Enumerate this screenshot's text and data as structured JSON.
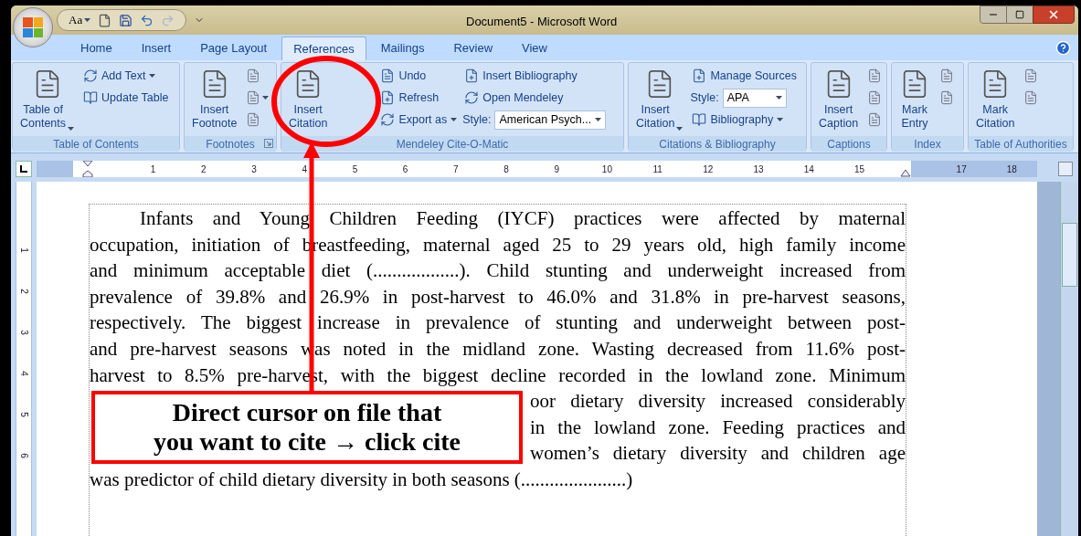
{
  "title_bar": {
    "quick_access_font": "Aa",
    "title": "Document5 - Microsoft Word"
  },
  "tabs": [
    {
      "label": "Home",
      "selected": false
    },
    {
      "label": "Insert",
      "selected": false
    },
    {
      "label": "Page Layout",
      "selected": false
    },
    {
      "label": "References",
      "selected": true
    },
    {
      "label": "Mailings",
      "selected": false
    },
    {
      "label": "Review",
      "selected": false
    },
    {
      "label": "View",
      "selected": false
    }
  ],
  "ribbon_groups": [
    {
      "name": "Table of Contents",
      "launcher": false,
      "columns": [
        [
          {
            "kind": "large",
            "label": "Table of\nContents",
            "dropdown": true
          }
        ],
        [
          {
            "kind": "small",
            "label": "Add Text",
            "dropdown": true
          },
          {
            "kind": "small",
            "label": "Update Table",
            "dropdown": false
          }
        ]
      ]
    },
    {
      "name": "Footnotes",
      "launcher": true,
      "columns": [
        [
          {
            "kind": "large",
            "label": "Insert\nFootnote",
            "dropdown": false
          }
        ],
        [
          {
            "kind": "icon",
            "dropdown": false
          },
          {
            "kind": "icon",
            "dropdown": true
          },
          {
            "kind": "icon",
            "dropdown": false
          }
        ]
      ]
    },
    {
      "name": "Mendeley Cite-O-Matic",
      "launcher": false,
      "columns": [
        [
          {
            "kind": "large",
            "label": "Insert\nCitation",
            "dropdown": false
          }
        ],
        [
          {
            "kind": "small",
            "label": "Undo",
            "dropdown": false
          },
          {
            "kind": "small",
            "label": "Refresh",
            "dropdown": false
          },
          {
            "kind": "small",
            "label": "Export as",
            "dropdown": true
          }
        ],
        [
          {
            "kind": "small",
            "label": "Insert Bibliography",
            "dropdown": false
          },
          {
            "kind": "small",
            "label": "Open Mendeley",
            "dropdown": false
          },
          {
            "kind": "combo",
            "label": "Style:",
            "value": "American Psych...",
            "dropdown": true
          }
        ]
      ]
    },
    {
      "name": "Citations & Bibliography",
      "launcher": false,
      "columns": [
        [
          {
            "kind": "large",
            "label": "Insert\nCitation",
            "dropdown": true
          }
        ],
        [
          {
            "kind": "small",
            "label": "Manage Sources",
            "dropdown": false
          },
          {
            "kind": "combo",
            "label": "Style:",
            "value": "APA",
            "dropdown": true
          },
          {
            "kind": "small",
            "label": "Bibliography",
            "dropdown": true
          }
        ]
      ]
    },
    {
      "name": "Captions",
      "launcher": false,
      "columns": [
        [
          {
            "kind": "large",
            "label": "Insert\nCaption",
            "dropdown": false
          }
        ],
        [
          {
            "kind": "icon",
            "dropdown": false
          },
          {
            "kind": "icon",
            "dropdown": false
          },
          {
            "kind": "icon",
            "dropdown": false
          }
        ]
      ]
    },
    {
      "name": "Index",
      "launcher": false,
      "columns": [
        [
          {
            "kind": "large",
            "label": "Mark\nEntry",
            "dropdown": false
          }
        ],
        [
          {
            "kind": "icon",
            "dropdown": false
          },
          {
            "kind": "icon",
            "dropdown": false
          }
        ]
      ]
    },
    {
      "name": "Table of Authorities",
      "launcher": false,
      "columns": [
        [
          {
            "kind": "large",
            "label": "Mark\nCitation",
            "dropdown": false
          }
        ],
        [
          {
            "kind": "icon",
            "dropdown": false
          },
          {
            "kind": "icon",
            "dropdown": false
          }
        ]
      ]
    }
  ],
  "ruler": [
    "1",
    "2",
    "3",
    "4",
    "5",
    "6",
    "7",
    "8",
    "9",
    "10",
    "11",
    "12",
    "13",
    "14",
    "15",
    "17",
    "18"
  ],
  "vertical_ruler": [
    "1",
    "2",
    "3",
    "4",
    "5",
    "6"
  ],
  "document_lines": [
    {
      "kind": "first",
      "text": "Infants and Young Children Feeding (IYCF) practices were affected by maternal"
    },
    {
      "kind": "full",
      "text": "occupation, initiation of breastfeeding, maternal aged 25 to 29 years old, high family income"
    },
    {
      "kind": "full",
      "text": "and minimum acceptable diet (..................). Child stunting and underweight increased from"
    },
    {
      "kind": "full",
      "text": "prevalence of 39.8% and 26.9% in post-harvest to 46.0% and 31.8% in pre-harvest seasons,"
    },
    {
      "kind": "full",
      "text": "respectively. The biggest increase in prevalence of stunting and underweight between post-"
    },
    {
      "kind": "full",
      "text": "and pre-harvest seasons was noted in the midland zone. Wasting decreased from 11.6% post-"
    },
    {
      "kind": "full",
      "text": "harvest to 8.5% pre-harvest, with the biggest decline recorded in the lowland zone. Minimum"
    },
    {
      "kind": "partial",
      "text": "oor dietary diversity increased considerably"
    },
    {
      "kind": "partial",
      "text": "in the lowland zone. Feeding practices and"
    },
    {
      "kind": "partial",
      "text": "women’s dietary diversity and children age"
    },
    {
      "kind": "last",
      "text": "was predictor of child dietary diversity in both seasons (......................)"
    }
  ],
  "callout": {
    "text": "Direct cursor on file that you want to cite → click cite"
  }
}
